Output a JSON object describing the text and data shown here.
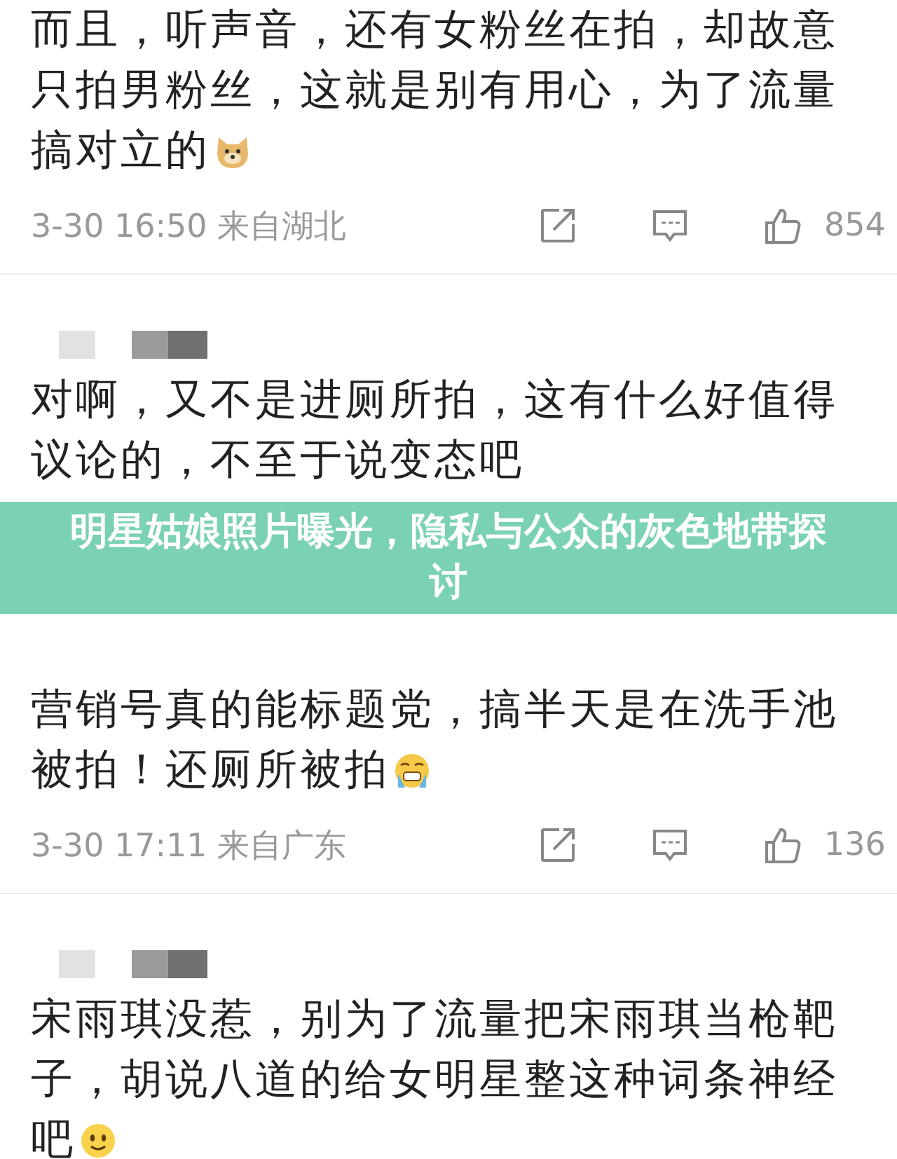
{
  "comments": [
    {
      "username_blurred": false,
      "lines": [
        "而且，听声音，还有女粉丝在拍，却故意",
        "只拍男粉丝，这就是别有用心，为了流量",
        "搞对立的"
      ],
      "emoji": {
        "kind": "dog"
      },
      "meta": {
        "time": "3-30 16:50 来自湖北",
        "likes": "854"
      }
    },
    {
      "username_blurred": true,
      "lines": [
        "对啊，又不是进厕所拍，这有什么好值得",
        "议论的，不至于说变态吧"
      ]
    },
    {
      "username_blurred": false,
      "lines": [
        "营销号真的能标题党，搞半天是在洗手池",
        "被拍！还厕所被拍"
      ],
      "emoji": {
        "kind": "sweat"
      },
      "meta": {
        "time": "3-30 17:11 来自广东",
        "likes": "136"
      }
    },
    {
      "username_blurred": true,
      "lines": [
        "宋雨琪没惹，别为了流量把宋雨琪当枪靶",
        "子，胡说八道的给女明星整这种词条神经",
        "吧"
      ],
      "emoji": {
        "kind": "smile"
      }
    }
  ],
  "banner": {
    "title": "明星姑娘照片曝光，隐私与公众的灰色地带探讨"
  }
}
